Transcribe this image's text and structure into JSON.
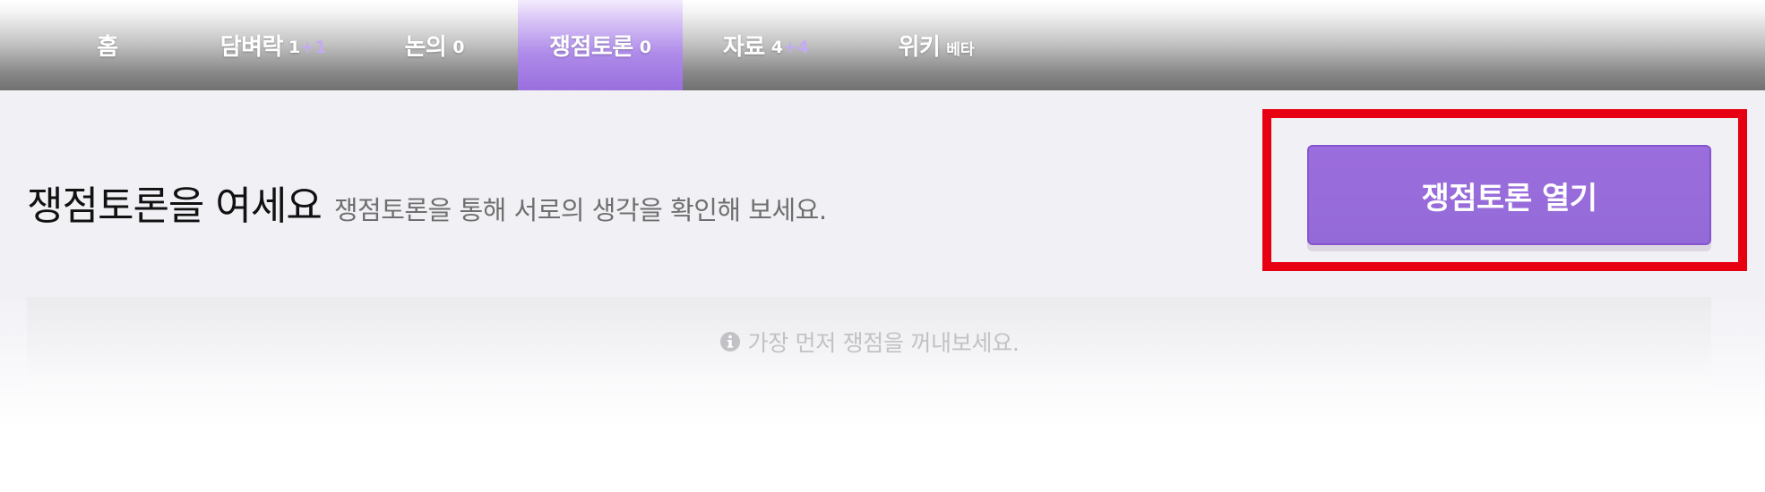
{
  "tabs": [
    {
      "label": "홈",
      "count": "",
      "extra": "",
      "badge": ""
    },
    {
      "label": "담벼락",
      "count": "1",
      "extra": "+1",
      "badge": ""
    },
    {
      "label": "논의",
      "count": "0",
      "extra": "",
      "badge": ""
    },
    {
      "label": "쟁점토론",
      "count": "0",
      "extra": "",
      "badge": "",
      "active": true
    },
    {
      "label": "자료",
      "count": "4",
      "extra": "+4",
      "badge": ""
    },
    {
      "label": "위키",
      "count": "",
      "extra": "",
      "badge": "베타"
    }
  ],
  "main": {
    "title": "쟁점토론을 여세요",
    "subtitle": "쟁점토론을 통해 서로의 생각을 확인해 보세요.",
    "open_button_label": "쟁점토론 열기",
    "empty_message": "가장 먼저 쟁점을 꺼내보세요.",
    "empty_icon": "info-circle-icon"
  },
  "colors": {
    "accent": "#9b6ddd",
    "extra_count": "#c3aaf2",
    "highlight": "#e60012"
  }
}
